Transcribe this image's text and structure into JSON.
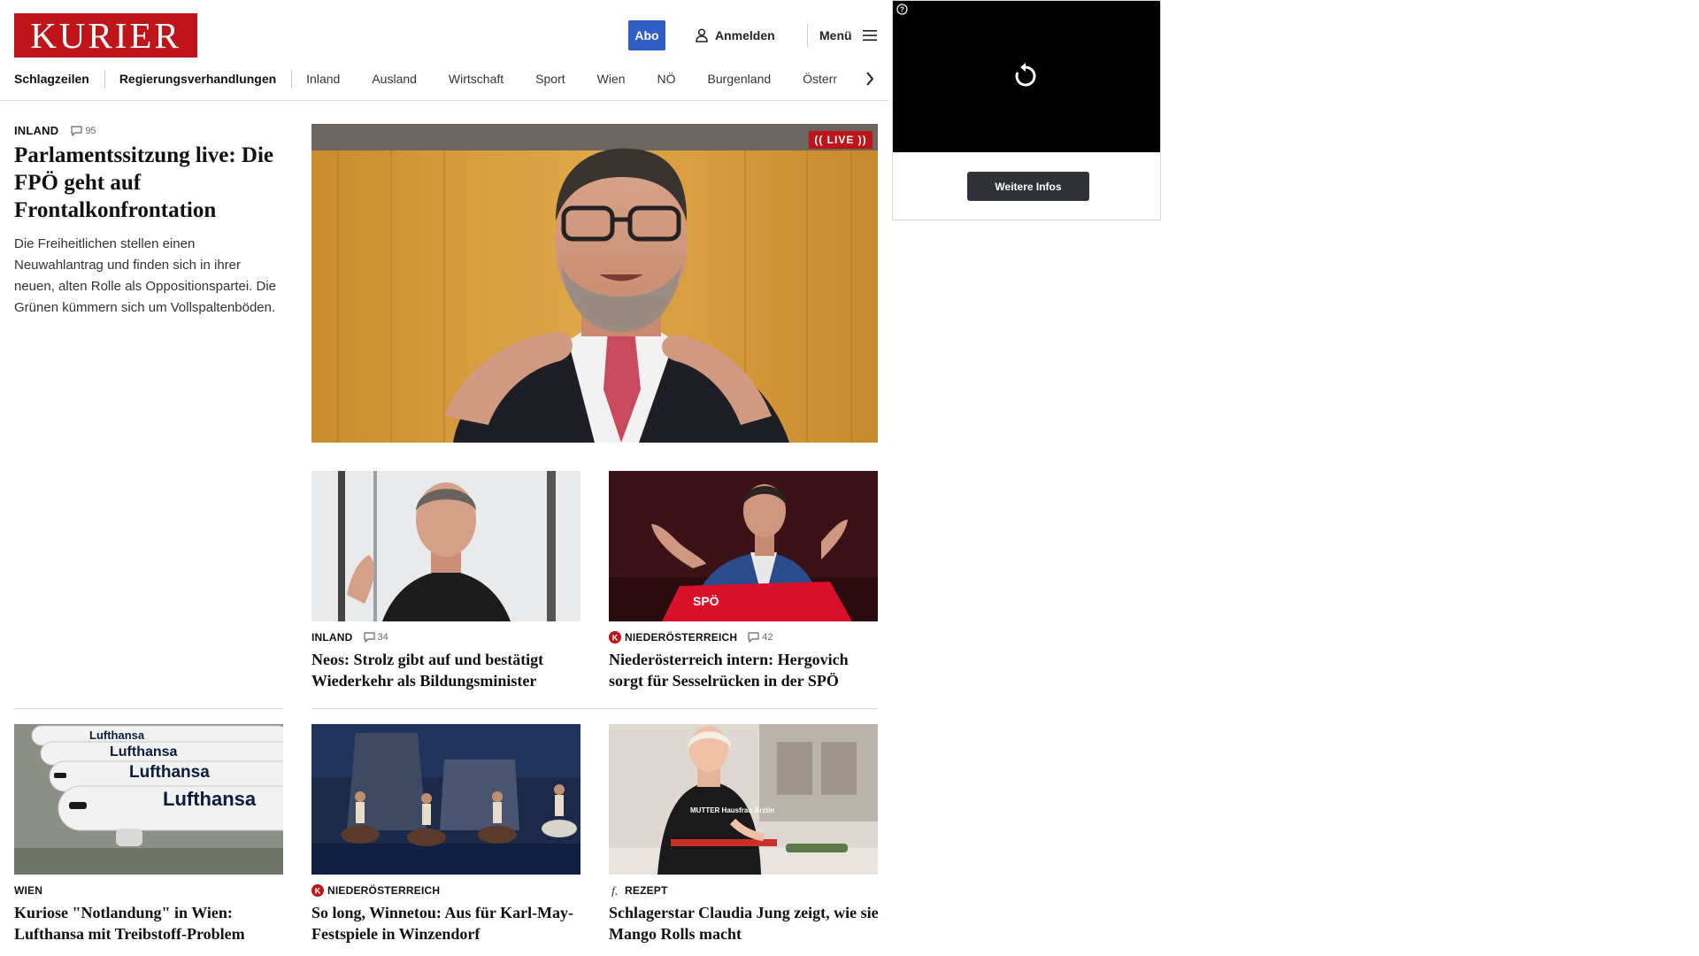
{
  "header": {
    "logo_text": "KURIER",
    "abo_label": "Abo",
    "login_label": "Anmelden",
    "menu_label": "Menü"
  },
  "nav": {
    "items": [
      "Schlagzeilen",
      "Regierungsverhandlungen",
      "Inland",
      "Ausland",
      "Wirtschaft",
      "Sport",
      "Wien",
      "NÖ",
      "Burgenland",
      "Österr"
    ]
  },
  "lead": {
    "category": "INLAND",
    "comments": "95",
    "title": "Parlamentssitzung live: Die FPÖ geht auf Frontalkonfrontation",
    "teaser": "Die Freiheitlichen stellen einen Neuwahlantrag und finden sich in ihrer neuen, alten Rolle als Oppositionspartei. Die Grünen kümmern sich um Vollspaltenböden.",
    "live_badge": "(( LIVE ))"
  },
  "articles": [
    {
      "category": "INLAND",
      "comments": "34",
      "title": "Neos: Strolz gibt auf und bestätigt Wiederkehr als Bildungsminister"
    },
    {
      "category": "NIEDERÖSTERREICH",
      "comments": "42",
      "title": "Niederösterreich intern: Hergovich sorgt für Sesselrücken in der SPÖ"
    },
    {
      "category": "WIEN",
      "title": "Kuriose \"Notlandung\" in Wien: Lufthansa mit Treibstoff-Problem"
    },
    {
      "category": "NIEDERÖSTERREICH",
      "title": "So long, Winnetou: Aus für Karl-May-Festspiele in Winzendorf"
    },
    {
      "category": "REZEPT",
      "title": "Schlagerstar Claudia Jung zeigt, wie sie Mango Rolls macht"
    }
  ],
  "images": {
    "lufthansa_text": "Lufthansa",
    "spo_text": "SPÖ",
    "shirt_text": "MUTTER Hausfrau Ärztin"
  },
  "ad": {
    "button_label": "Weitere Infos"
  },
  "colors": {
    "brand_red": "#c0141b",
    "abo_blue": "#2f5fc4",
    "ad_button": "#2f3236"
  },
  "icons": [
    "user-icon",
    "hamburger-icon",
    "chevron-right-icon",
    "comment-icon",
    "kurier-k-icon",
    "freizeit-f-icon",
    "replay-icon",
    "help-icon"
  ]
}
